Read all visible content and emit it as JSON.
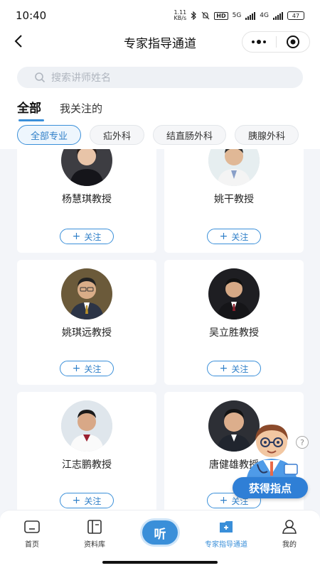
{
  "status_bar": {
    "time": "10:40",
    "net_speed_value": "1.11",
    "net_speed_unit": "KB/s",
    "hd_label": "HD",
    "net1": "5G",
    "net2": "4G",
    "battery": "47"
  },
  "header": {
    "title": "专家指导通道"
  },
  "search": {
    "placeholder": "搜索讲师姓名"
  },
  "tabs": [
    {
      "label": "全部",
      "active": true
    },
    {
      "label": "我关注的",
      "active": false
    }
  ],
  "chips": [
    {
      "label": "全部专业",
      "active": true
    },
    {
      "label": "疝外科",
      "active": false
    },
    {
      "label": "结直肠外科",
      "active": false
    },
    {
      "label": "胰腺外科",
      "active": false
    }
  ],
  "experts": [
    {
      "name": "杨慧琪教授",
      "follow_label": "关注"
    },
    {
      "name": "姚干教授",
      "follow_label": "关注"
    },
    {
      "name": "姚琪远教授",
      "follow_label": "关注"
    },
    {
      "name": "吴立胜教授",
      "follow_label": "关注"
    },
    {
      "name": "江志鹏教授",
      "follow_label": "关注"
    },
    {
      "name": "唐健雄教授",
      "follow_label": "关注"
    }
  ],
  "floating_helper": {
    "label": "获得指点",
    "help_mark": "?"
  },
  "bottom_nav": {
    "items": [
      {
        "label": "首页",
        "icon": "home-icon"
      },
      {
        "label": "资料库",
        "icon": "book-icon"
      },
      {
        "label": "听",
        "icon": "listen-button"
      },
      {
        "label": "专家指导通道",
        "icon": "expert-channel-icon",
        "active": true
      },
      {
        "label": "我的",
        "icon": "profile-icon"
      }
    ]
  },
  "colors": {
    "accent": "#3a8fd9",
    "background": "#f3f5f9"
  }
}
